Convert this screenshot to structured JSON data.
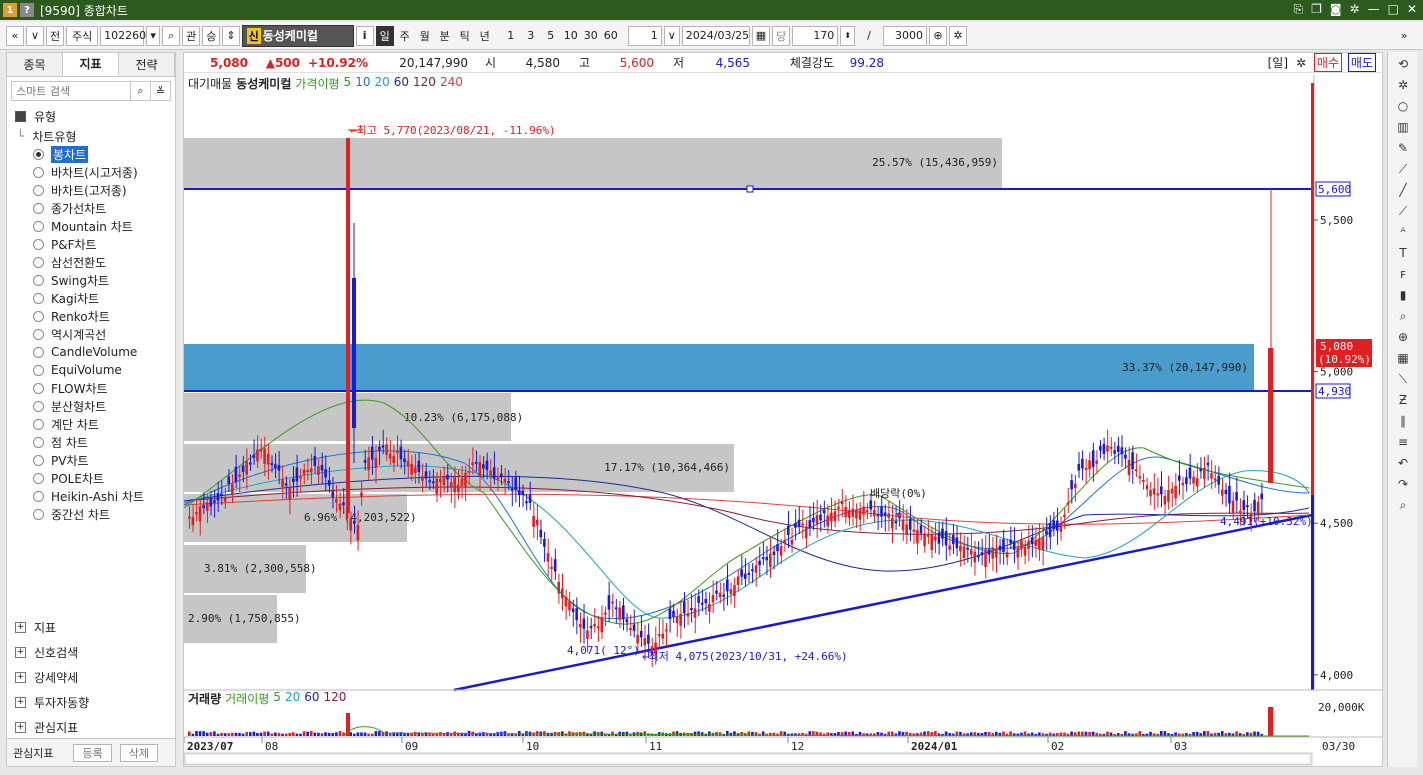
{
  "window": {
    "title": "[9590] 종합차트",
    "icon_labels": [
      "1",
      "?"
    ]
  },
  "toolbar": {
    "nav_prev": "«",
    "nav_more": "»",
    "market_short": "전",
    "market_type": "주식",
    "stock_code": "102260",
    "rel_label": "관",
    "sort_label": "승",
    "stock_badge": "신",
    "stock_name": "동성케미컬",
    "info_label": "i",
    "periods": [
      "일",
      "주",
      "월",
      "분",
      "틱",
      "년"
    ],
    "active_period": "일",
    "intervals": [
      "1",
      "3",
      "5",
      "10",
      "30",
      "60"
    ],
    "interval_value": "1",
    "date": "2024/03/25",
    "dang_label": "당",
    "count": "170",
    "total": "3000"
  },
  "left_panel": {
    "tabs": [
      "종목",
      "지표",
      "전략"
    ],
    "active_tab": "지표",
    "search_placeholder": "스마트 검색",
    "group_label": "유형",
    "subgroup_label": "차트유형",
    "chart_types": [
      "봉차트",
      "바차트(시고저종)",
      "바차트(고저종)",
      "종가선차트",
      "Mountain 차트",
      "P&F차트",
      "삼선전환도",
      "Swing차트",
      "Kagi차트",
      "Renko차트",
      "역시계곡선",
      "CandleVolume",
      "EquiVolume",
      "FLOW차트",
      "분산형차트",
      "계단 차트",
      "점 차트",
      "PV차트",
      "POLE차트",
      "Heikin-Ashi 차트",
      "중간선 차트"
    ],
    "selected_type": "봉차트",
    "folders": [
      "지표",
      "신호검색",
      "강세약세",
      "투자자동향",
      "관심지표"
    ],
    "bottom_label": "관심지표",
    "register_label": "등록",
    "delete_label": "삭제"
  },
  "quote": {
    "price": "5,080",
    "change": "▲500",
    "change_pct": "+10.92%",
    "volume": "20,147,990",
    "open_label": "시",
    "open": "4,580",
    "high_label": "고",
    "high": "5,600",
    "low_label": "저",
    "low": "4,565",
    "strength_label": "체결강도",
    "strength": "99.28",
    "period_badge": "[일]",
    "buy_label": "매수",
    "sell_label": "매도"
  },
  "price_legend": {
    "supply": "대기매물",
    "name": "동성케미컬",
    "ma_label": "가격이평",
    "ma": [
      "5",
      "10",
      "20",
      "60",
      "120",
      "240"
    ],
    "ma_colors": [
      "#3a9b1a",
      "#1e73d9",
      "#1aa3c8",
      "#1a2a9b",
      "#8b1a3a",
      "#e04040"
    ]
  },
  "volume_legend": {
    "label": "거래량",
    "ma_label": "거래이평",
    "ma": [
      "5",
      "20",
      "60",
      "120"
    ],
    "ma_colors": [
      "#3a9b1a",
      "#1aa3c8",
      "#1a2a9b",
      "#8b1a3a"
    ]
  },
  "annotations": {
    "high": "←최고 5,770(2023/08/21, -11.96%)",
    "low": "←최저 4,075(2023/10/31, +24.66%)",
    "low_trend": "4,071(  12°)",
    "right_trend": "4,491(+10.32%)",
    "ex_rights": "배당락(0%)"
  },
  "volume_profile": [
    {
      "label": "25.57% (15,436,959)",
      "highlight": false
    },
    {
      "label": "33.37% (20,147,990)",
      "highlight": true
    },
    {
      "label": "10.23% (6,175,088)",
      "highlight": false
    },
    {
      "label": "17.17% (10,364,466)",
      "highlight": false
    },
    {
      "label": "6.96% (4,203,522)",
      "highlight": false
    },
    {
      "label": "3.81% (2,300,558)",
      "highlight": false
    },
    {
      "label": "2.90% (1,750,855)",
      "highlight": false
    }
  ],
  "price_axis": {
    "ticks": [
      "5,500",
      "5,000",
      "4,500",
      "4,000"
    ],
    "hline_labels": [
      "5,600",
      "4,930"
    ],
    "current": "5,080",
    "current_pct": "(10.92%)"
  },
  "volume_axis": {
    "tick": "20,000K"
  },
  "time_axis": {
    "ticks": [
      "2023/07",
      "08",
      "09",
      "10",
      "11",
      "12",
      "2024/01",
      "02",
      "03"
    ],
    "last_date": "03/30"
  },
  "right_tools": [
    "refresh-icon",
    "gear-icon",
    "circle-icon",
    "bar-chart-icon",
    "pencil-icon",
    "ruler-icon",
    "line-icon",
    "diagonal-icon",
    "auto-icon",
    "text-icon",
    "fibo-icon",
    "candle-icon",
    "zoom-icon",
    "zoom-plus-icon",
    "grid-icon",
    "trend-icon",
    "z-icon",
    "bars-icon",
    "lines-icon",
    "undo-icon",
    "redo-icon",
    "magnify-icon"
  ],
  "colors": {
    "up": "#e02020",
    "down": "#1a1ad0",
    "hline": "#1a1ad0",
    "profile": "#c6c6c6",
    "profile_highlight": "#4a9ccc"
  }
}
